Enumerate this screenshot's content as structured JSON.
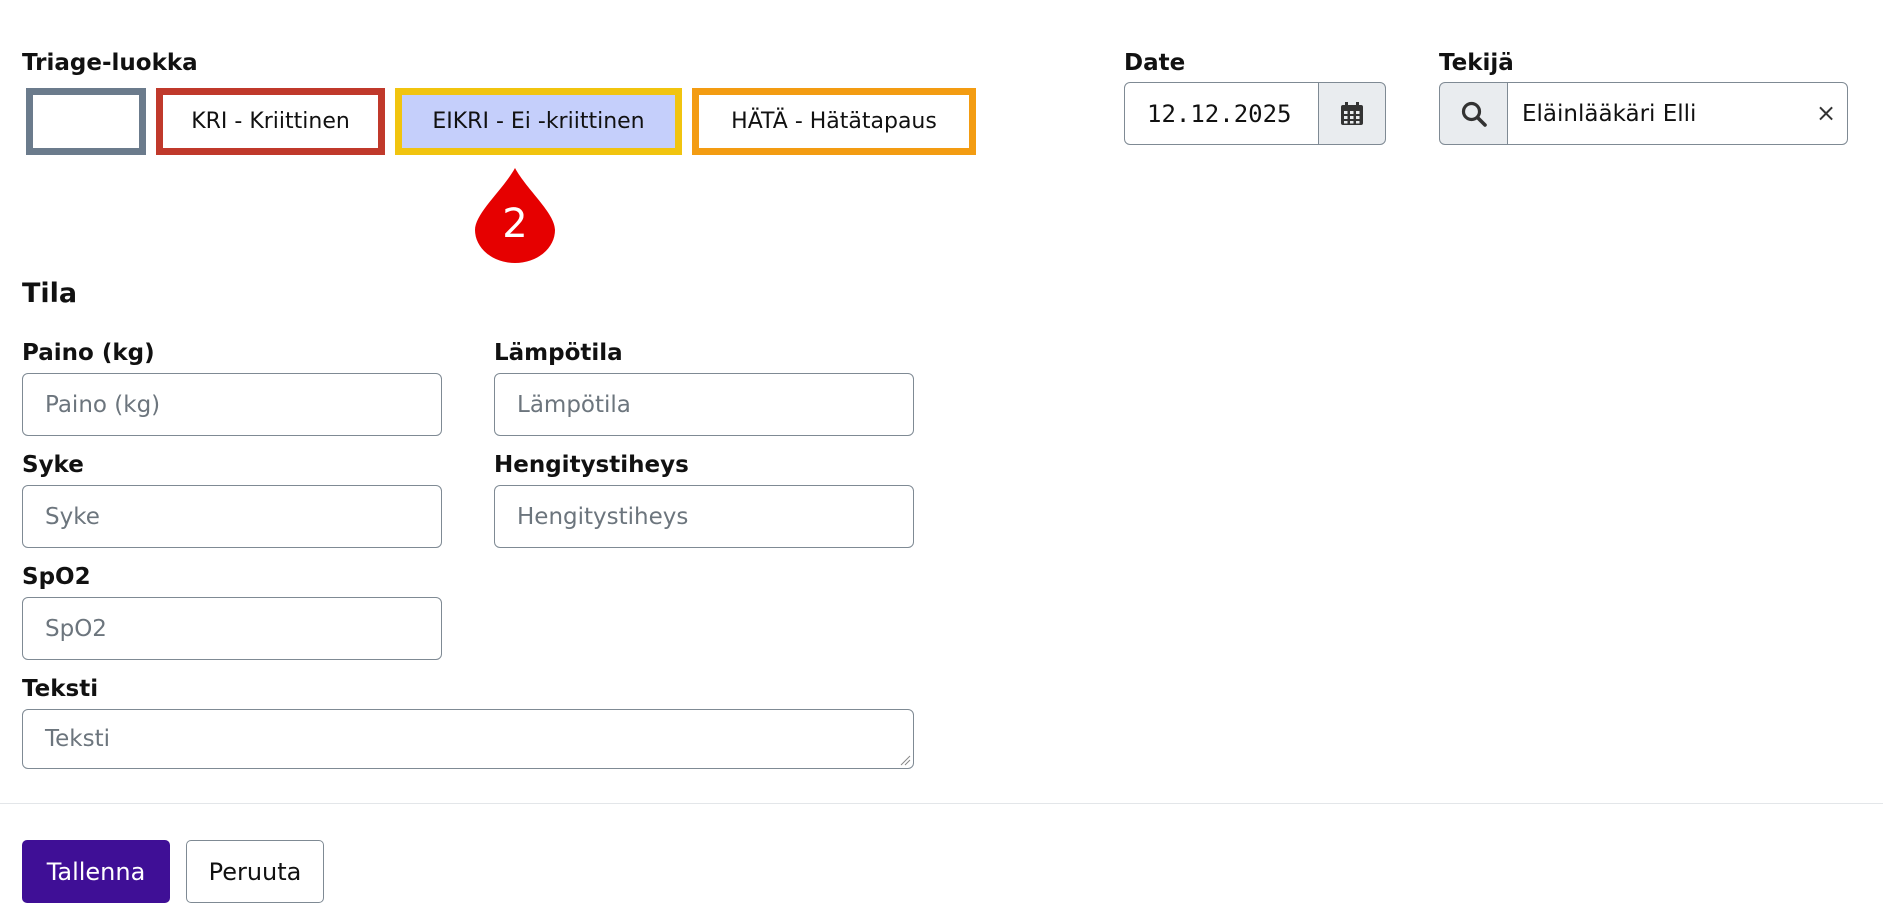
{
  "triage": {
    "label": "Triage-luokka",
    "options": [
      {
        "label": "",
        "color": "#6b7b8c",
        "selected": false
      },
      {
        "label": "KRI - Kriittinen",
        "color": "#c0392b",
        "selected": false
      },
      {
        "label": "EIKRI - Ei -kriittinen",
        "color": "#f1c40f",
        "selected": true,
        "selected_bg": "#c5cffb"
      },
      {
        "label": "HÄTÄ - Hätätapaus",
        "color": "#f39c12",
        "selected": false
      }
    ]
  },
  "marker": {
    "number": "2",
    "color": "#e60000"
  },
  "date": {
    "label": "Date",
    "value": "12.12.2025",
    "button_icon": "calendar-icon"
  },
  "tekija": {
    "label": "Tekijä",
    "value": "Eläinlääkäri Elli",
    "search_icon": "search-icon",
    "clear": "×"
  },
  "tila": {
    "title": "Tila"
  },
  "fields": {
    "paino": {
      "label": "Paino (kg)",
      "placeholder": "Paino (kg)"
    },
    "lampotila": {
      "label": "Lämpötila",
      "placeholder": "Lämpötila"
    },
    "syke": {
      "label": "Syke",
      "placeholder": "Syke"
    },
    "hengitystiheys": {
      "label": "Hengitystiheys",
      "placeholder": "Hengitystiheys"
    },
    "spo2": {
      "label": "SpO2",
      "placeholder": "SpO2"
    },
    "teksti": {
      "label": "Teksti",
      "placeholder": "Teksti"
    }
  },
  "actions": {
    "save": "Tallenna",
    "cancel": "Peruuta"
  },
  "colors": {
    "primary": "#3f0f96"
  }
}
